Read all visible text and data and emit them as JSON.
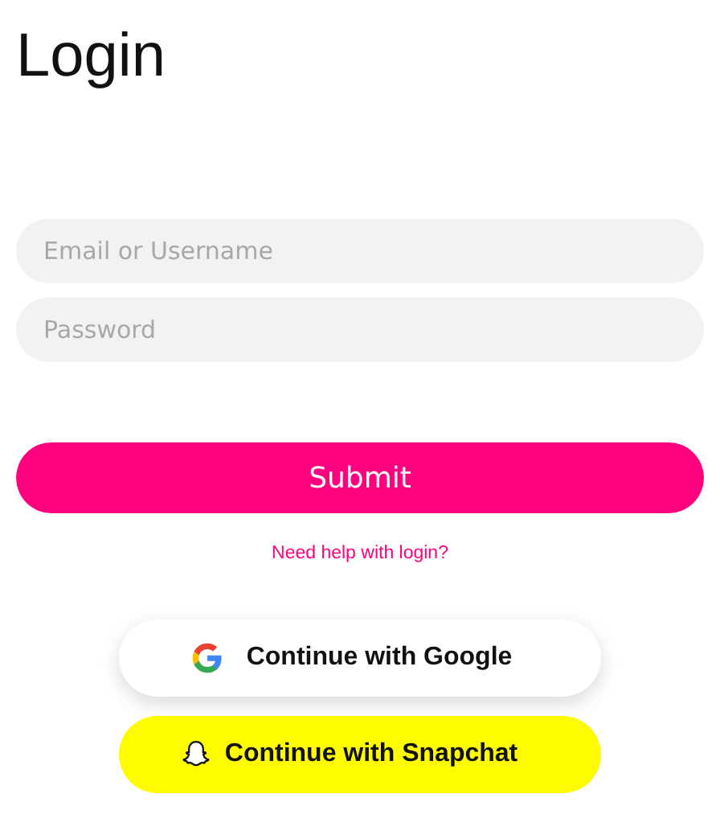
{
  "title": "Login",
  "fields": [
    {
      "placeholder": "Email or Username"
    },
    {
      "placeholder": "Password"
    }
  ],
  "submit": "Submit",
  "help_link": "Need help with login?",
  "social_buttons": [
    {
      "kind": "google",
      "label": "Continue with Google"
    },
    {
      "kind": "snapchat",
      "label": "Continue with Snapchat"
    }
  ]
}
